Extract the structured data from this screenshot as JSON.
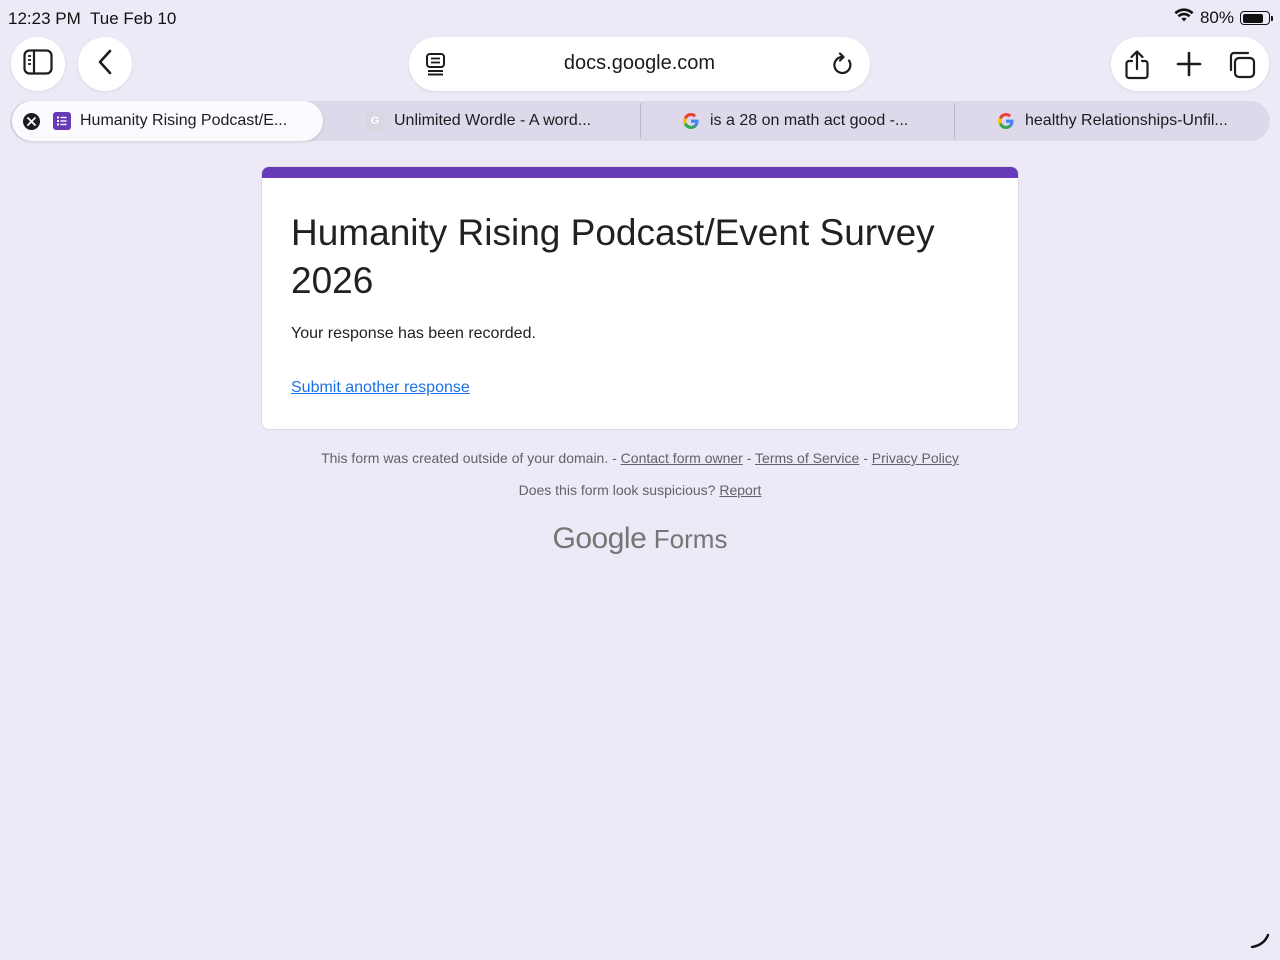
{
  "status_bar": {
    "time": "12:23 PM",
    "date": "Tue Feb 10",
    "battery": "80%",
    "battery_level": 0.8
  },
  "toolbar": {
    "address": "docs.google.com"
  },
  "tabs": [
    {
      "title": "Humanity Rising Podcast/E...",
      "favicon": "forms-icon",
      "active": true
    },
    {
      "title": "Unlimited Wordle - A word...",
      "favicon": "generic-g-icon",
      "active": false
    },
    {
      "title": "is a 28 on math act good -...",
      "favicon": "google-g-icon",
      "active": false
    },
    {
      "title": "healthy Relationships-Unfil...",
      "favicon": "google-g-icon",
      "active": false
    }
  ],
  "form": {
    "title": "Humanity Rising Podcast/Event Survey 2026",
    "confirmation": "Your response has been recorded.",
    "another_response": "Submit another response",
    "accent_color": "#673ab7"
  },
  "footer": {
    "created_outside": "This form was created outside of your domain. -",
    "contact_owner": "Contact form owner",
    "sep1": "-",
    "terms": "Terms of Service",
    "sep2": "-",
    "privacy": "Privacy Policy",
    "suspicious": "Does this form look suspicious?",
    "report": "Report",
    "brand_google": "Google",
    "brand_forms": "Forms"
  },
  "colors": {
    "background": "#ede9f6",
    "link": "#1a73e8"
  }
}
